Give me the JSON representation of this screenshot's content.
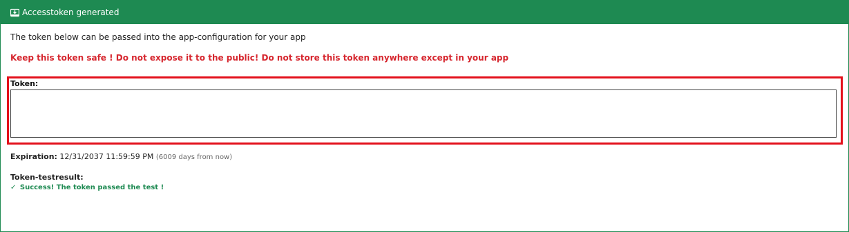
{
  "header": {
    "title": "Accesstoken generated",
    "icon": "download-box-icon",
    "bg_color": "#1e8a52"
  },
  "main": {
    "description": "The token below can be passed into the app-configuration for your app",
    "warning": "Keep this token safe ! Do not expose it to the public! Do not store this token anywhere except in your app",
    "warning_color": "#d6262e",
    "highlight_color": "#e3101b",
    "token": {
      "label": "Token:",
      "value": ""
    },
    "expiration": {
      "label": "Expiration:",
      "value": "12/31/2037 11:59:59 PM",
      "relative": "(6009 days from now)"
    },
    "testresult": {
      "label": "Token-testresult:",
      "check_glyph": "✓",
      "message": "Success! The token passed the test !",
      "color": "#1e8a52"
    }
  }
}
